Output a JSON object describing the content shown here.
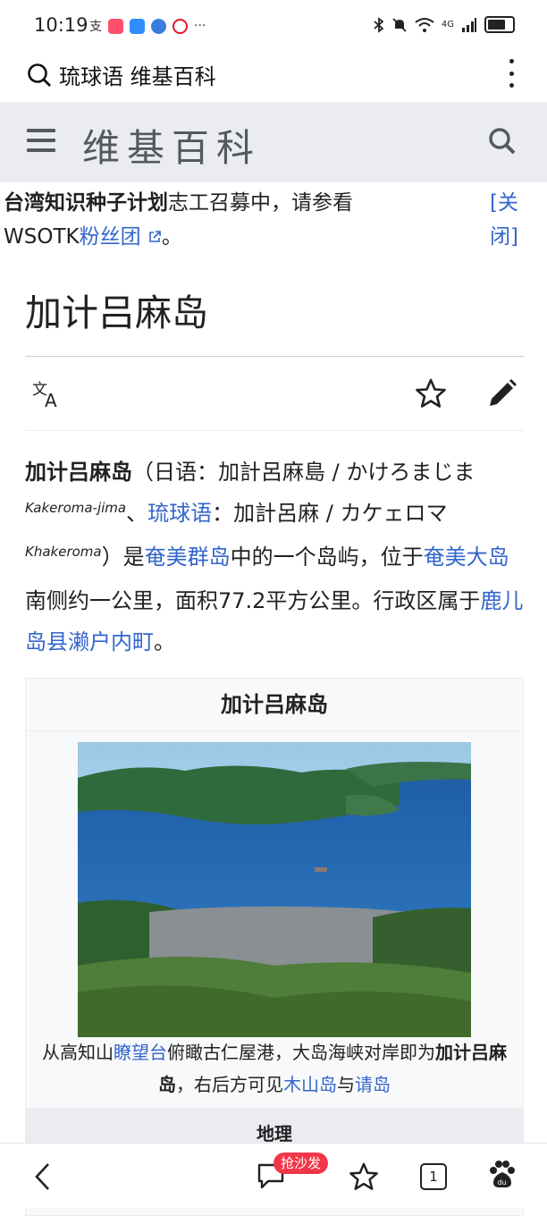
{
  "status": {
    "time": "10:19",
    "apps": [
      "支",
      "▮",
      "✉",
      "●",
      "◉"
    ],
    "more": "···",
    "network": "4G"
  },
  "browser": {
    "search_query": "琉球语 维基百科",
    "tab_count": "1",
    "badge": "抢沙发"
  },
  "wiki": {
    "logo": "维基百科"
  },
  "banner": {
    "bold": "台湾知识种子计划",
    "text": "志工召募中，请参看",
    "prefix": "WSOTK",
    "link": "粉丝团",
    "suffix": "。",
    "close_open": "[",
    "close_label": "关闭",
    "close_end": "]"
  },
  "page": {
    "title": "加计吕麻岛"
  },
  "lead": {
    "name_bold": "加计吕麻岛",
    "part1": "（日语：加計呂麻島 / かけろまじま",
    "jp_roman": "Kakeroma-jima",
    "sep": "、",
    "link_ryukyuan": "琉球语",
    "part2": "：加計呂麻 / カケェロマ",
    "ry_roman": "Khakeroma",
    "part3": "）是",
    "link_amami_islands": "奄美群岛",
    "part4": "中的一个岛屿，位于",
    "link_amami_oshima": "奄美大岛",
    "part5": "南侧约一公里，面积77.2平方公里。行政区属于",
    "link_setouchi": "鹿儿岛县濑户内町",
    "part6": "。"
  },
  "infobox": {
    "title": "加计吕麻岛",
    "caption_a": "从高知山",
    "caption_link1": "瞭望台",
    "caption_b": "俯瞰古仁屋港，大岛海峡对岸即为",
    "caption_bold": "加计吕麻岛",
    "caption_c": "，右后方可见",
    "caption_link2": "木山岛",
    "caption_d": "与",
    "caption_link3": "请岛",
    "section": "地理"
  },
  "colors": {
    "link": "#3366cc",
    "header_bg": "#eaecf0",
    "badge": "#f2364a"
  }
}
